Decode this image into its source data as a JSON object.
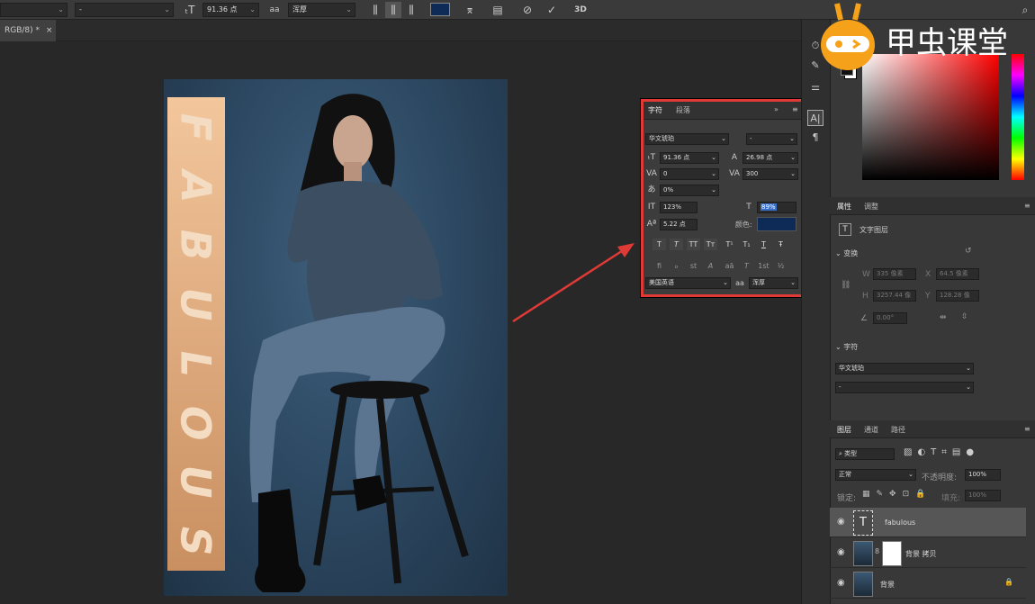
{
  "option_bar": {
    "font_family": "",
    "font_style": "-",
    "font_size": "91.36 点",
    "aa_label": "a",
    "anti_alias": "浑厚",
    "threed_label": "3D"
  },
  "document_tab": {
    "label": "RGB/8) *"
  },
  "watermark": {
    "text": "甲虫课堂"
  },
  "canvas_text": {
    "letters": [
      "F",
      "A",
      "B",
      "U",
      "L",
      "O",
      "U",
      "S"
    ]
  },
  "character_panel": {
    "tab_character": "字符",
    "tab_paragraph": "段落",
    "font_family": "华文琥珀",
    "font_style": "-",
    "size": "91.36 点",
    "leading": "26.98 点",
    "kerning": "0",
    "tracking": "300",
    "tsume": "0%",
    "vertical_scale": "123%",
    "horizontal_scale": "89%",
    "baseline_shift": "5.22 点",
    "color_label": "颜色:",
    "color": "#0e2a57",
    "language": "美国英语",
    "aa_label": "a",
    "anti_alias": "浑厚",
    "style_buttons": [
      "T",
      "T",
      "TT",
      "Tт",
      "T¹",
      "T₁",
      "T",
      "Ŧ"
    ],
    "opentype_buttons": [
      "fi",
      "ℴ",
      "st",
      "A",
      "aā",
      "T",
      "1st",
      "½"
    ]
  },
  "properties_panel": {
    "tab_properties": "属性",
    "tab_adjustments": "调整",
    "layer_type": "文字图层",
    "transform_label": "变换",
    "w_label": "W",
    "w_value": "335 像素",
    "x_label": "X",
    "x_value": "64.5 像素",
    "h_label": "H",
    "h_value": "3257.44 像",
    "y_label": "Y",
    "y_value": "128.28 像",
    "angle": "0.00°",
    "char_label": "字符",
    "font_family": "华文琥珀",
    "font_style": "-"
  },
  "layers_panel": {
    "tab_layers": "图层",
    "tab_channels": "通道",
    "tab_paths": "路径",
    "filter_label": "类型",
    "blend_mode": "正常",
    "opacity_label": "不透明度:",
    "opacity": "100%",
    "lock_label": "锁定:",
    "fill_label": "填充:",
    "fill": "100%",
    "layers": [
      {
        "name": "fabulous",
        "type": "text",
        "selected": true
      },
      {
        "name": "背景 拷贝",
        "type": "image",
        "selected": false
      },
      {
        "name": "背景",
        "type": "image",
        "selected": false
      }
    ]
  },
  "colors": {
    "annotation_red": "#e03a37",
    "panel_bg": "#3c3c3c",
    "canvas_bg": "#282828",
    "strip_peach": "#f3c69c"
  }
}
